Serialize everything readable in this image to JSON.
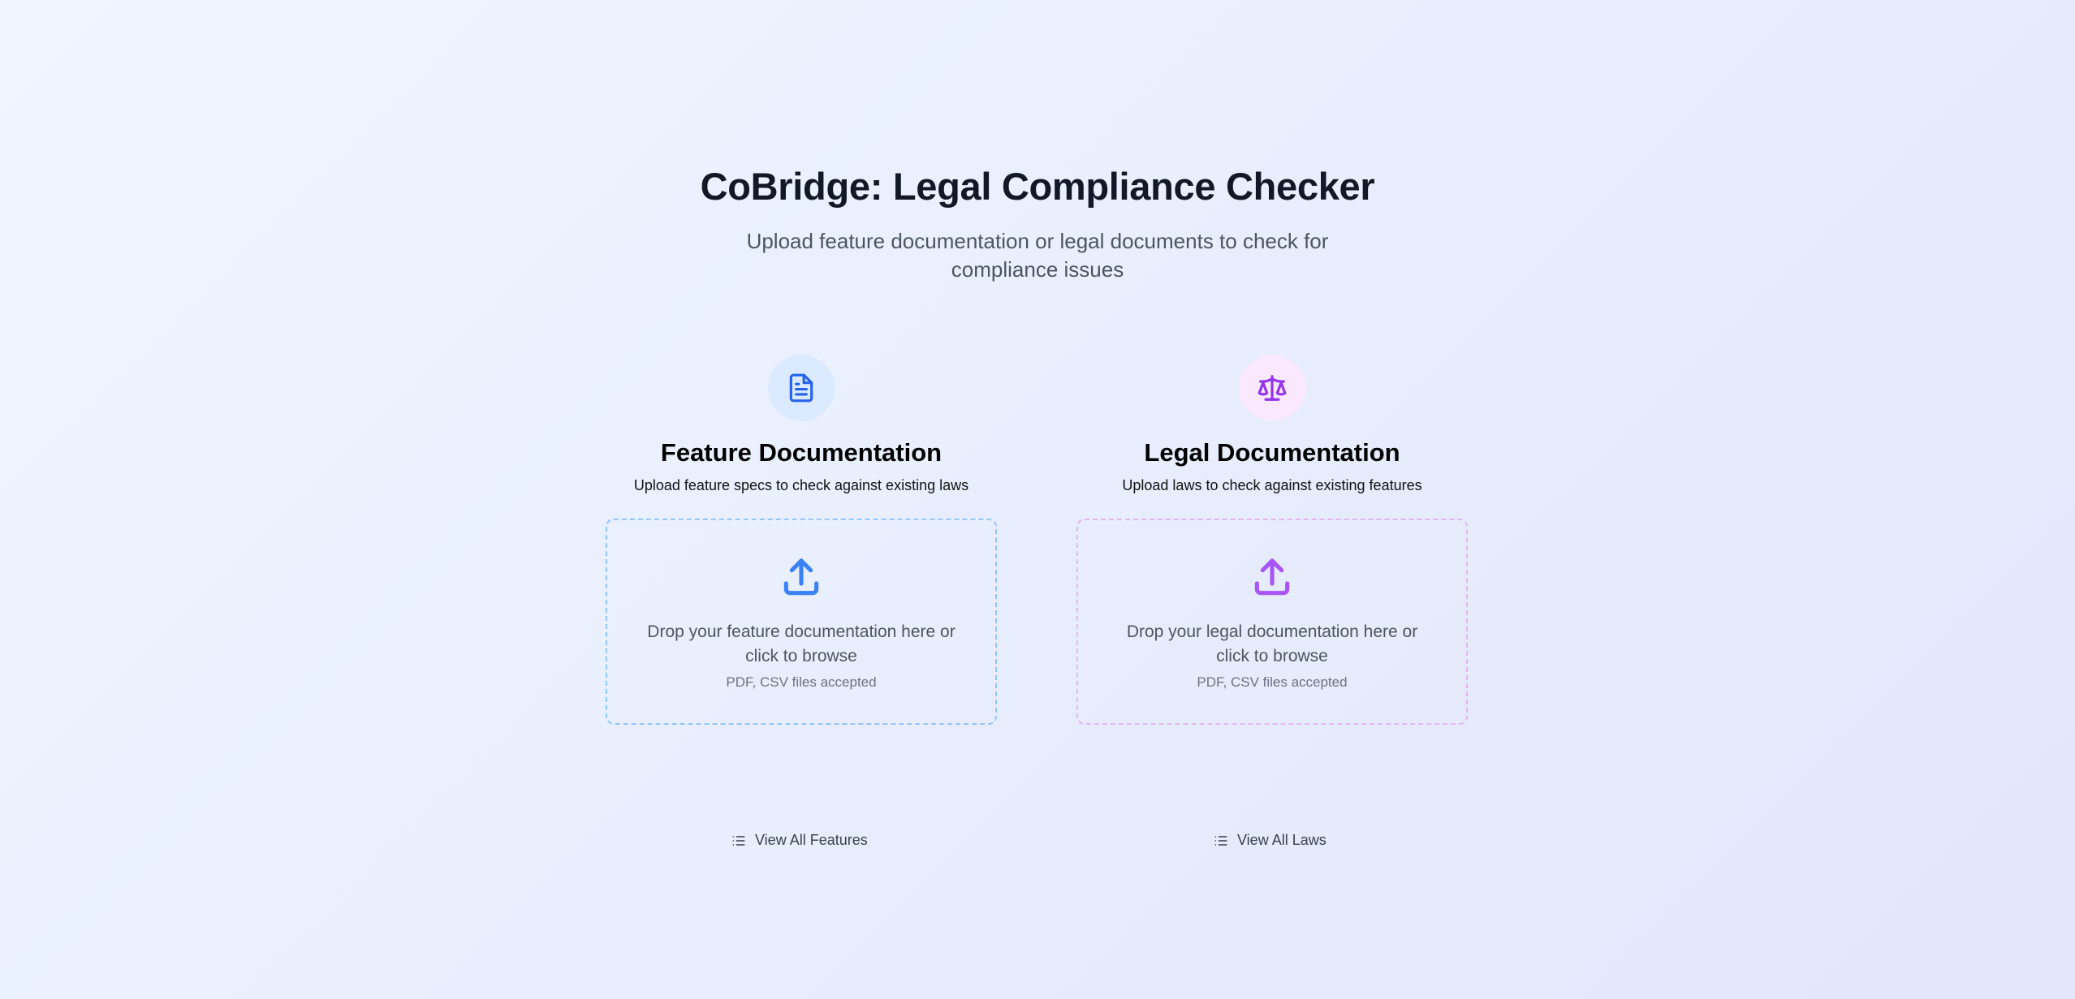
{
  "header": {
    "title": "CoBridge: Legal Compliance Checker",
    "subtitle": "Upload feature documentation or legal documents to check for compliance issues"
  },
  "feature_section": {
    "icon": "document-icon",
    "title": "Feature Documentation",
    "description": "Upload feature specs to check against existing laws",
    "dropzone": {
      "icon": "upload-icon",
      "text": "Drop your feature documentation here or click to browse",
      "hint": "PDF, CSV files accepted"
    },
    "accent_color": "#2563eb",
    "link": {
      "icon": "list-icon",
      "label": "View All Features"
    }
  },
  "legal_section": {
    "icon": "scale-icon",
    "title": "Legal Documentation",
    "description": "Upload laws to check against existing features",
    "dropzone": {
      "icon": "upload-icon",
      "text": "Drop your legal documentation here or click to browse",
      "hint": "PDF, CSV files accepted"
    },
    "accent_color": "#9333ea",
    "link": {
      "icon": "list-icon",
      "label": "View All Laws"
    }
  }
}
